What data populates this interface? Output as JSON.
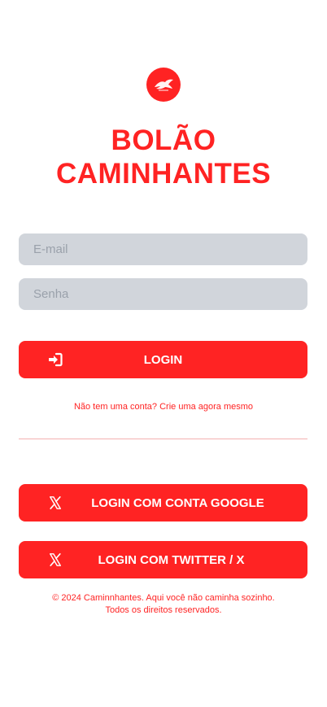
{
  "brand": {
    "title_line1": "BOLÃO",
    "title_line2": "CAMINHANTES",
    "logo_icon": "eagle-logo-icon",
    "accent_color": "#ff2323"
  },
  "form": {
    "email_placeholder": "E-mail",
    "email_value": "",
    "password_placeholder": "Senha",
    "password_value": "",
    "login_label": "LOGIN",
    "login_icon": "sign-in-icon"
  },
  "signup_text": "Não tem uma conta? Crie uma agora mesmo",
  "social": {
    "google_label": "LOGIN COM CONTA GOOGLE",
    "google_icon": "x-icon",
    "twitter_label": "LOGIN COM TWITTER / X",
    "twitter_icon": "x-icon"
  },
  "footer": {
    "line1": "© 2024 Caminnhantes. Aqui você não caminha sozinho.",
    "line2": "Todos os direitos reservados."
  }
}
